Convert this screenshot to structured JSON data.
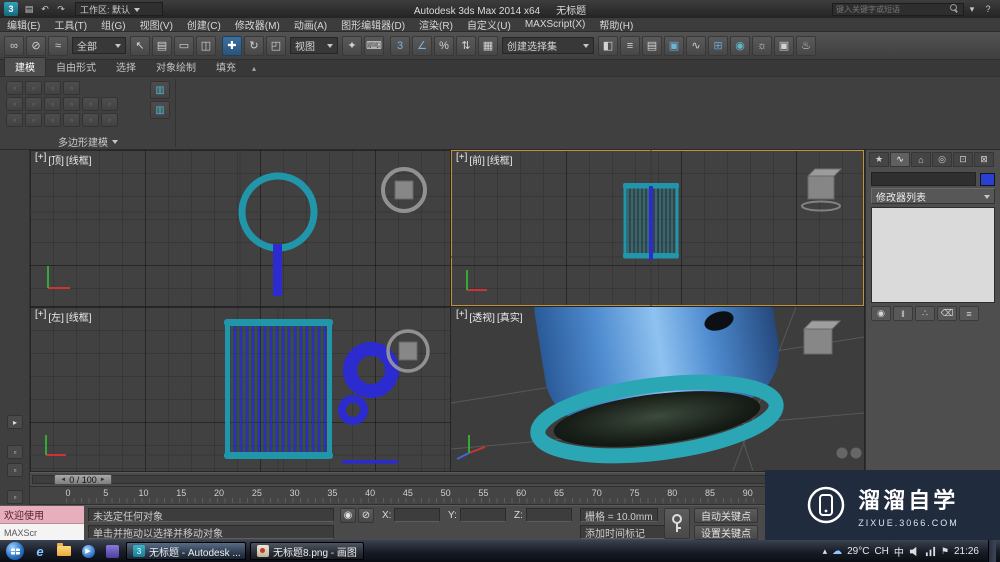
{
  "titlebar": {
    "logo_glyph": "3",
    "quick_icons": [
      {
        "name": "save-icon",
        "glyph": "▤"
      },
      {
        "name": "undo-icon",
        "glyph": "↶"
      },
      {
        "name": "redo-icon",
        "glyph": "↷"
      }
    ],
    "workspace_label": "工作区: 默认",
    "app_title": "Autodesk 3ds Max  2014 x64",
    "doc_title": "无标题",
    "search_placeholder": "键入关键字或短语",
    "right_icons": [
      {
        "name": "search-go-icon",
        "glyph": "▾"
      },
      {
        "name": "help-icon",
        "glyph": "?"
      }
    ]
  },
  "menubar": {
    "items": [
      "编辑(E)",
      "工具(T)",
      "组(G)",
      "视图(V)",
      "创建(C)",
      "修改器(M)",
      "动画(A)",
      "图形编辑器(D)",
      "渲染(R)",
      "自定义(U)",
      "MAXScript(X)",
      "帮助(H)"
    ]
  },
  "toolbar": {
    "icons_a": [
      {
        "name": "select-and-link-icon",
        "glyph": "∞"
      },
      {
        "name": "unlink-selection-icon",
        "glyph": "⊘"
      },
      {
        "name": "bind-to-space-warp-icon",
        "glyph": "≈"
      }
    ],
    "selection_filter": "全部",
    "icons_b": [
      {
        "name": "select-object-icon",
        "glyph": "↖"
      },
      {
        "name": "select-by-name-icon",
        "glyph": "▤"
      },
      {
        "name": "rectangular-region-icon",
        "glyph": "▭"
      },
      {
        "name": "window-crossing-icon",
        "glyph": "◫"
      }
    ],
    "icons_c": [
      {
        "name": "select-and-move-icon",
        "glyph": "✚",
        "active": true
      },
      {
        "name": "select-and-rotate-icon",
        "glyph": "↻"
      },
      {
        "name": "select-and-scale-icon",
        "glyph": "◰"
      }
    ],
    "coord_system": "视图",
    "icons_d": [
      {
        "name": "select-and-manipulate-icon",
        "glyph": "✦"
      },
      {
        "name": "keyboard-override-icon",
        "glyph": "⌨"
      }
    ],
    "icons_e": [
      {
        "name": "snap-toggle-3d-icon",
        "glyph": "3",
        "tint": "#7ab4e0"
      },
      {
        "name": "angle-snap-icon",
        "glyph": "∠",
        "tint": "#7ab4e0"
      },
      {
        "name": "percent-snap-icon",
        "glyph": "%"
      },
      {
        "name": "spinner-snap-icon",
        "glyph": "⇅"
      }
    ],
    "icons_f": [
      {
        "name": "edit-named-selection-sets-icon",
        "glyph": "▦"
      }
    ],
    "named_selection": "创建选择集",
    "icons_g": [
      {
        "name": "mirror-icon",
        "glyph": "◧"
      },
      {
        "name": "align-icon",
        "glyph": "≡"
      },
      {
        "name": "layer-manager-icon",
        "glyph": "▤"
      },
      {
        "name": "ribbon-toggle-icon",
        "glyph": "▣",
        "tint": "#6db3d8"
      },
      {
        "name": "curve-editor-icon",
        "glyph": "∿"
      },
      {
        "name": "schematic-view-icon",
        "glyph": "⊞",
        "tint": "#6d9fd0"
      },
      {
        "name": "material-editor-icon",
        "glyph": "◉",
        "tint": "#5fb7c8"
      },
      {
        "name": "render-setup-icon",
        "glyph": "☼"
      },
      {
        "name": "rendered-frame-icon",
        "glyph": "▣"
      },
      {
        "name": "render-production-icon",
        "glyph": "♨"
      }
    ]
  },
  "ribbon": {
    "tabs": [
      {
        "label": "建模",
        "active": true
      },
      {
        "label": "自由形式"
      },
      {
        "label": "选择"
      },
      {
        "label": "对象绘制"
      },
      {
        "label": "填充"
      }
    ],
    "minimize_glyph": "▴",
    "panel_label": "多边形建模"
  },
  "viewports": {
    "top_left": {
      "plus": "[+]",
      "view": "[顶]",
      "shading": "[线框]"
    },
    "top_right": {
      "plus": "[+]",
      "view": "[前]",
      "shading": "[线框]"
    },
    "bottom_left": {
      "plus": "[+]",
      "view": "[左]",
      "shading": "[线框]"
    },
    "bottom_right": {
      "plus": "[+]",
      "view": "[透视]",
      "shading": "[真实]"
    }
  },
  "command_panel": {
    "tabs": [
      {
        "name": "create-tab-icon",
        "glyph": "★"
      },
      {
        "name": "modify-tab-icon",
        "glyph": "∿",
        "active": true
      },
      {
        "name": "hierarchy-tab-icon",
        "glyph": "⌂"
      },
      {
        "name": "motion-tab-icon",
        "glyph": "◎"
      },
      {
        "name": "display-tab-icon",
        "glyph": "⊡"
      },
      {
        "name": "utilities-tab-icon",
        "glyph": "⊠"
      }
    ],
    "object_name": "",
    "modifier_list_label": "修改器列表",
    "stack_buttons": [
      {
        "name": "pin-stack-icon",
        "glyph": "◉"
      },
      {
        "name": "show-end-result-icon",
        "glyph": "‖"
      },
      {
        "name": "make-unique-icon",
        "glyph": "∴"
      },
      {
        "name": "remove-modifier-icon",
        "glyph": "⌫"
      },
      {
        "name": "configure-modifier-sets-icon",
        "glyph": "≡"
      }
    ]
  },
  "timeline": {
    "slider_label": "0 / 100",
    "ticks": [
      "0",
      "5",
      "10",
      "15",
      "20",
      "25",
      "30",
      "35",
      "40",
      "45",
      "50",
      "55",
      "60",
      "65",
      "70",
      "75",
      "80",
      "85",
      "90"
    ]
  },
  "statusbar": {
    "welcome_pink": "欢迎使用",
    "listener_white": "MAXScr",
    "prompt_selection": "未选定任何对象",
    "prompt_hint": "单击并拖动以选择并移动对象",
    "x_label": "X:",
    "y_label": "Y:",
    "z_label": "Z:",
    "x_value": "",
    "y_value": "",
    "z_value": "",
    "grid_label": "栅格 = 10.0mm",
    "add_time_tag": "添加时间标记",
    "auto_key": "自动关键点",
    "set_key": "设置关键点"
  },
  "watermark": {
    "brand": "溜溜自学",
    "site": "ZIXUE.3066.COM"
  },
  "taskbar": {
    "window1": "无标题 - Autodesk ...",
    "window2": "无标题8.png - 画图",
    "tray_temp": "29°C",
    "lang1": "CH",
    "lang2": "中",
    "time": "21:26"
  }
}
